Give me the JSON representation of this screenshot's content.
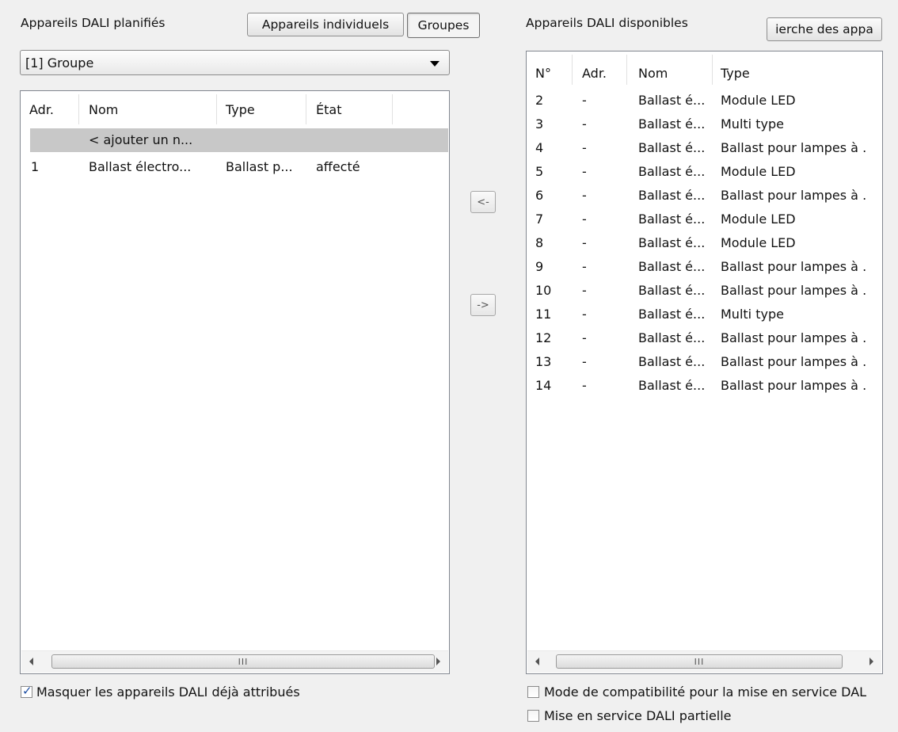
{
  "left_panel": {
    "title": "Appareils DALI planifiés",
    "tabs": [
      "Appareils individuels",
      "Groupes"
    ],
    "group_select": {
      "value": "[1] Groupe"
    },
    "table": {
      "headers": [
        "Adr.",
        "Nom",
        "Type",
        "État"
      ],
      "placeholder_row": {
        "name": "< ajouter un n..."
      },
      "rows": [
        {
          "adr": "1",
          "nom": "Ballast électro...",
          "type": "Ballast p...",
          "etat": "affecté"
        }
      ]
    },
    "scroll_grip": "III",
    "hide_assigned": {
      "label": "Masquer les appareils DALI déjà attribués",
      "checked": true
    }
  },
  "transfer": {
    "to_left": "<-",
    "to_right": "->"
  },
  "right_panel": {
    "title": "Appareils DALI disponibles",
    "search_button": "ierche des appa",
    "table": {
      "headers": [
        "N°",
        "Adr.",
        "Nom",
        "Type"
      ],
      "rows": [
        {
          "no": "2",
          "adr": "-",
          "nom": "Ballast é...",
          "type": "Module LED"
        },
        {
          "no": "3",
          "adr": "-",
          "nom": "Ballast é...",
          "type": "Multi type"
        },
        {
          "no": "4",
          "adr": "-",
          "nom": "Ballast é...",
          "type": "Ballast pour lampes à ."
        },
        {
          "no": "5",
          "adr": "-",
          "nom": "Ballast é...",
          "type": "Module LED"
        },
        {
          "no": "6",
          "adr": "-",
          "nom": "Ballast é...",
          "type": "Ballast pour lampes à ."
        },
        {
          "no": "7",
          "adr": "-",
          "nom": "Ballast é...",
          "type": "Module LED"
        },
        {
          "no": "8",
          "adr": "-",
          "nom": "Ballast é...",
          "type": "Module LED"
        },
        {
          "no": "9",
          "adr": "-",
          "nom": "Ballast é...",
          "type": "Ballast pour lampes à ."
        },
        {
          "no": "10",
          "adr": "-",
          "nom": "Ballast é...",
          "type": "Ballast pour lampes à ."
        },
        {
          "no": "11",
          "adr": "-",
          "nom": "Ballast é...",
          "type": "Multi type"
        },
        {
          "no": "12",
          "adr": "-",
          "nom": "Ballast é...",
          "type": "Ballast pour lampes à ."
        },
        {
          "no": "13",
          "adr": "-",
          "nom": "Ballast é...",
          "type": "Ballast pour lampes à ."
        },
        {
          "no": "14",
          "adr": "-",
          "nom": "Ballast é...",
          "type": "Ballast pour lampes à ."
        }
      ]
    },
    "scroll_grip": "III",
    "compat_mode": {
      "label": "Mode de compatibilité pour la mise en service DAL",
      "checked": false
    },
    "partial_commission": {
      "label": "Mise en service DALI partielle",
      "checked": false
    }
  }
}
